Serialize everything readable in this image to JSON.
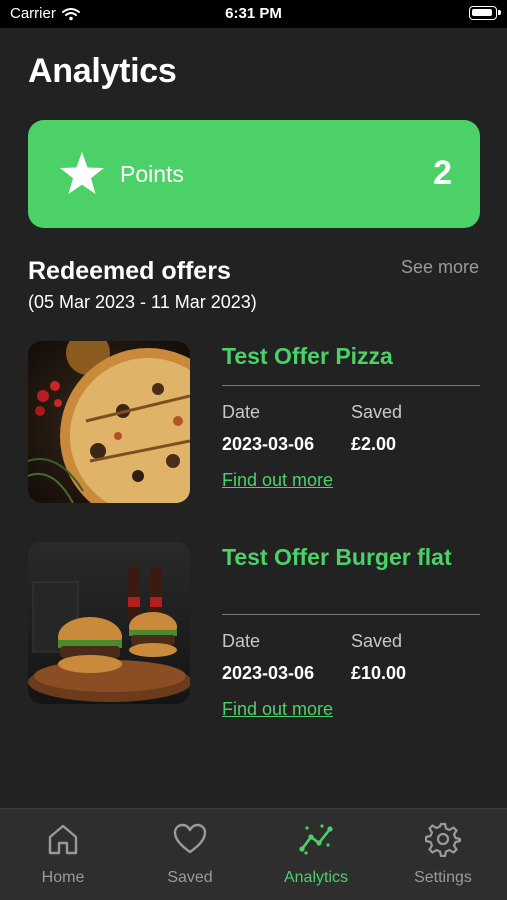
{
  "status_bar": {
    "carrier": "Carrier",
    "time": "6:31 PM"
  },
  "page": {
    "title": "Analytics"
  },
  "points": {
    "label": "Points",
    "value": "2",
    "accent": "#4cd168"
  },
  "redeemed": {
    "title": "Redeemed offers",
    "see_more": "See more",
    "date_range": "(05 Mar 2023 - 11 Mar 2023)",
    "offers": [
      {
        "title": "Test Offer Pizza",
        "image": "pizza-image",
        "date_label": "Date",
        "date": "2023-03-06",
        "saved_label": "Saved",
        "saved": "£2.00",
        "link": "Find out more"
      },
      {
        "title": "Test Offer Burger flat",
        "image": "burger-image",
        "date_label": "Date",
        "date": "2023-03-06",
        "saved_label": "Saved",
        "saved": "£10.00",
        "link": "Find out more"
      }
    ]
  },
  "tabs": [
    {
      "label": "Home",
      "icon": "home-icon",
      "active": false
    },
    {
      "label": "Saved",
      "icon": "heart-icon",
      "active": false
    },
    {
      "label": "Analytics",
      "icon": "analytics-icon",
      "active": true
    },
    {
      "label": "Settings",
      "icon": "gear-icon",
      "active": false
    }
  ]
}
